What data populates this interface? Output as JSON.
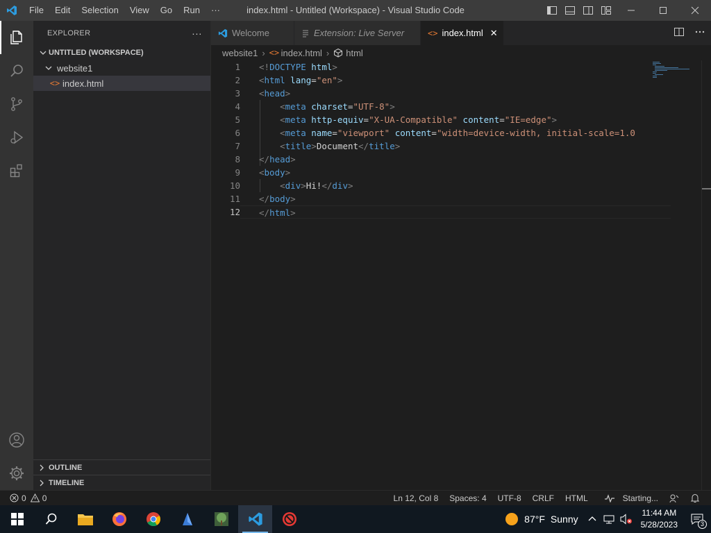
{
  "titlebar": {
    "menu": [
      "File",
      "Edit",
      "Selection",
      "View",
      "Go",
      "Run",
      "···"
    ],
    "title": "index.html - Untitled (Workspace) - Visual Studio Code"
  },
  "sidebar": {
    "header": "EXPLORER",
    "more": "···",
    "workspace": "UNTITLED (WORKSPACE)",
    "folder": "website1",
    "file": "index.html",
    "outline": "OUTLINE",
    "timeline": "TIMELINE"
  },
  "tabs": [
    {
      "label": "Welcome"
    },
    {
      "label": "Extension: Live Server"
    },
    {
      "label": "index.html",
      "close": "✕"
    }
  ],
  "breadcrumb": [
    "website1",
    "index.html",
    "html"
  ],
  "code": {
    "line_numbers": [
      "1",
      "2",
      "3",
      "4",
      "5",
      "6",
      "7",
      "8",
      "9",
      "10",
      "11",
      "12"
    ],
    "current_line": 12
  },
  "status": {
    "errors": "0",
    "warnings": "0",
    "position": "Ln 12, Col 8",
    "spaces": "Spaces: 4",
    "encoding": "UTF-8",
    "eol": "CRLF",
    "language": "HTML",
    "live": "Starting..."
  },
  "taskbar": {
    "temperature": "87°F",
    "weather": "Sunny",
    "time": "11:44 AM",
    "date": "5/28/2023",
    "notifications": "3"
  },
  "colors": {
    "accent": "#007acc",
    "tag": "#569cd6",
    "attribute": "#9cdcfe",
    "string": "#ce9178",
    "bracket": "#808080"
  }
}
